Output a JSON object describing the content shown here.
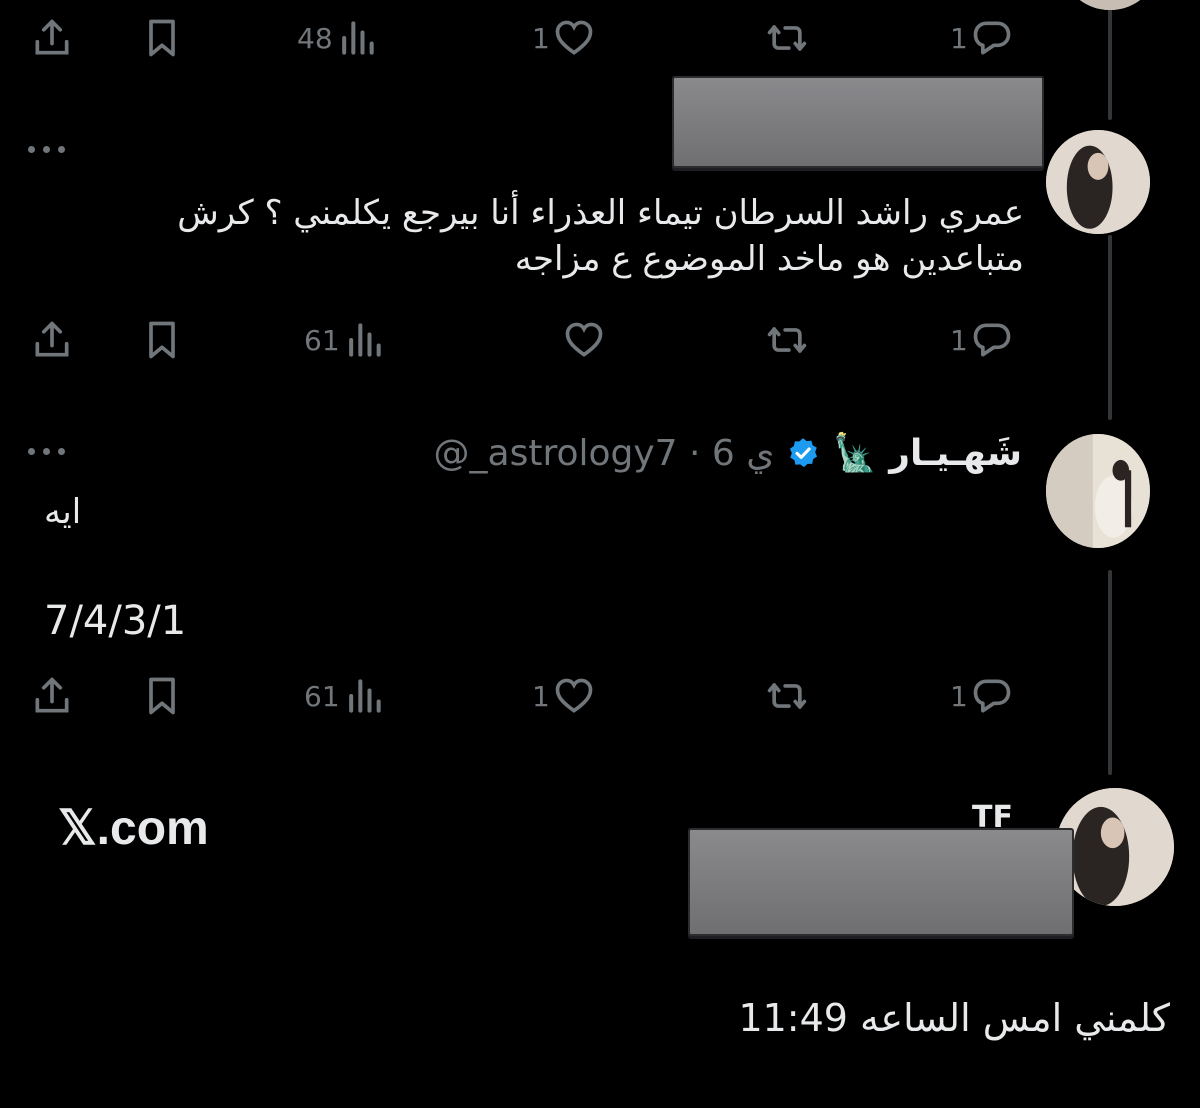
{
  "tweets": [
    {
      "actions": {
        "replies": "1",
        "reposts": "",
        "likes": "1",
        "views": "48"
      }
    },
    {
      "text": "عمري راشد السرطان تيماء العذراء أنا بيرجع يكلمني ؟ كرش متباعدين هو ماخد الموضوع ع مزاجه",
      "actions": {
        "replies": "1",
        "reposts": "",
        "likes": "",
        "views": "61"
      }
    },
    {
      "display_name": "شَهـيـار",
      "name_emoji": "🗽",
      "handle_time": "@_astrology7 · 6 ي",
      "text_line1": "ايه",
      "text_line2": "7/4/3/1",
      "actions": {
        "replies": "1",
        "reposts": "",
        "likes": "1",
        "views": "61"
      }
    }
  ],
  "watermark": "𝕏.com",
  "tf_label": "TF",
  "caption": "كلمني امس الساعه 11:49",
  "colors": {
    "background": "#000000",
    "text": "#e7e9ea",
    "muted": "#71767b",
    "verified": "#1d9bf0",
    "thread_line": "#333639"
  },
  "icons": [
    "share-icon",
    "bookmark-icon",
    "views-icon",
    "like-icon",
    "repost-icon",
    "reply-icon",
    "more-icon",
    "verified-badge-icon"
  ]
}
